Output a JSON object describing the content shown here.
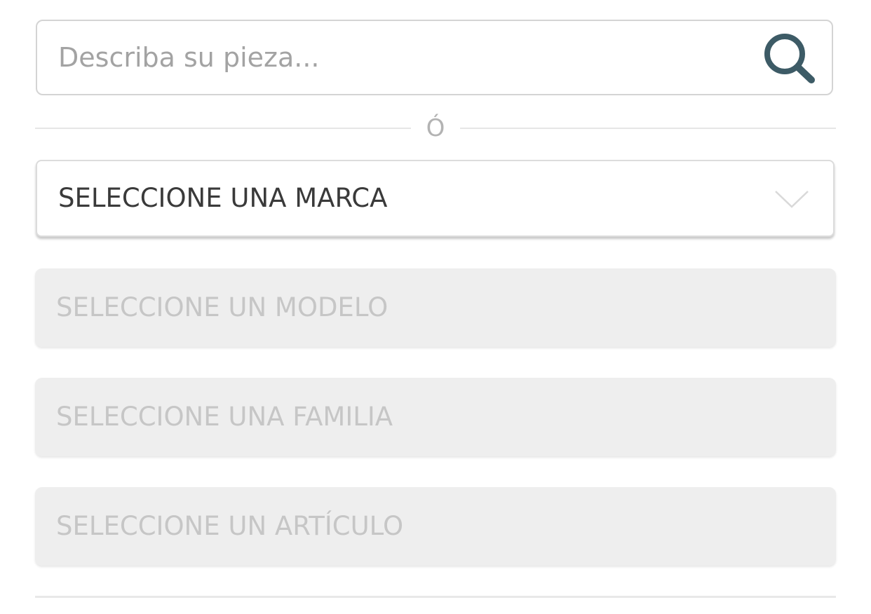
{
  "search": {
    "placeholder": "Describa su pieza...",
    "value": "",
    "icon": "search-icon",
    "icon_color": "#3d5b66"
  },
  "divider": {
    "text": "Ó"
  },
  "selects": {
    "brand": {
      "label": "SELECCIONE UNA MARCA",
      "icon": "chevron-down-icon",
      "enabled": true
    },
    "model": {
      "label": "SELECCIONE UN MODELO",
      "enabled": false
    },
    "family": {
      "label": "SELECCIONE UNA FAMILIA",
      "enabled": false
    },
    "article": {
      "label": "SELECCIONE UN ARTÍCULO",
      "enabled": false
    }
  }
}
